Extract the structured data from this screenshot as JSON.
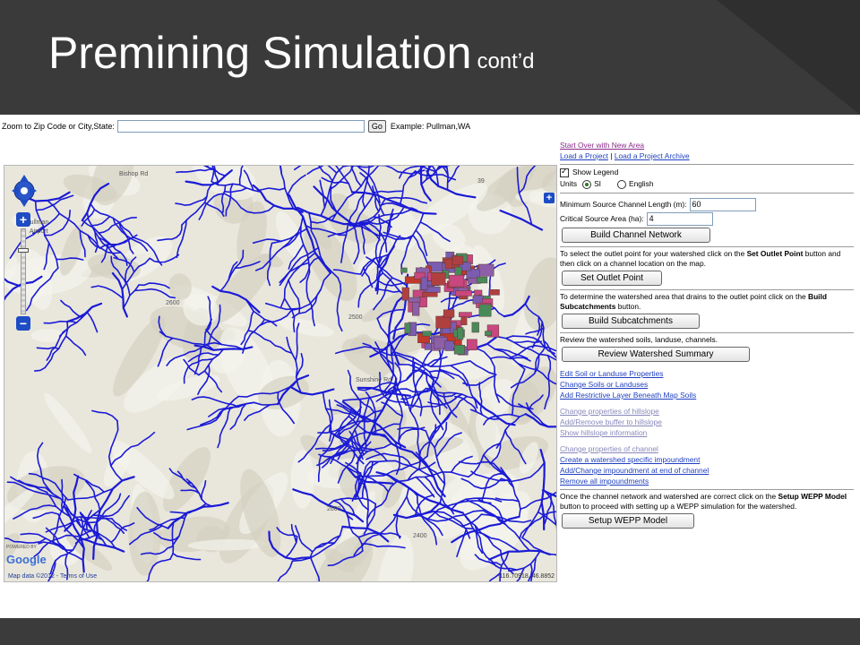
{
  "slide": {
    "title_main": "Premining Simulation",
    "title_sub": "cont’d"
  },
  "zoom_bar": {
    "label": "Zoom to Zip Code or City,State:",
    "input_value": "",
    "go_label": "Go",
    "example": "Example: Pullman,WA"
  },
  "map": {
    "google_powered": "POWERED BY",
    "google_logo": "Google",
    "terms": "Map data ©2012 - Terms of Use",
    "coords": "-116.70918, 46.8852",
    "place_labels": [
      "Pullman",
      "Airport",
      "Bishop Rd",
      "Sunshine Rd",
      "39",
      "2600",
      "2500",
      "2600",
      "2400"
    ],
    "icons": [
      "pan-control-icon",
      "zoom-in-icon",
      "zoom-out-icon",
      "expand-icon"
    ],
    "stream_color": "#1a1ad6",
    "watershed_colors": [
      "#7a5cb0",
      "#c0392b",
      "#c8477e",
      "#4a8a5a",
      "#8d5fa8",
      "#b04040"
    ]
  },
  "panel": {
    "start_over": "Start Over with New Area",
    "load_project": "Load a Project",
    "separator": "|",
    "load_archive": "Load a Project Archive",
    "show_legend": "Show Legend",
    "units_label": "Units",
    "unit_si": "SI",
    "unit_english": "English",
    "min_source_label": "Minimum Source Channel Length (m):",
    "min_source_value": "60",
    "critical_area_label": "Critical Source Area (ha):",
    "critical_area_value": "4",
    "build_channel_btn": "Build Channel Network",
    "outlet_text_1": "To select the outlet point for your watershed click on the",
    "outlet_text_bold": "Set Outlet Point",
    "outlet_text_2": "button and then click on a channel location on the map.",
    "set_outlet_btn": "Set Outlet Point",
    "subcatch_text_1": "To determine the watershed area that drains to the outlet point click on the",
    "subcatch_text_bold": "Build Subcatchments",
    "subcatch_text_2": "button.",
    "build_subcatch_btn": "Build Subcatchments",
    "review_text": "Review the watershed soils, landuse, channels.",
    "review_btn": "Review Watershed Summary",
    "links_soil": [
      "Edit Soil or Landuse Properties",
      "Change Soils or Landuses",
      "Add Restrictive Layer Beneath Map Soils"
    ],
    "links_hillslope": [
      "Change properties of hillslope",
      "Add/Remove buffer to hillslope",
      "Show hillslope information"
    ],
    "links_channel": [
      "Change properties of channel",
      "Create a watershed specific impoundment",
      "Add/Change impoundment at end of channel",
      "Remove all impoundments"
    ],
    "setup_text_1": "Once the channel network and watershed are correct click on the",
    "setup_text_bold1": "Setup WEPP Model",
    "setup_text_2": "button to proceed with setting up a WEPP simulation for the watershed.",
    "setup_btn": "Setup WEPP Model"
  }
}
